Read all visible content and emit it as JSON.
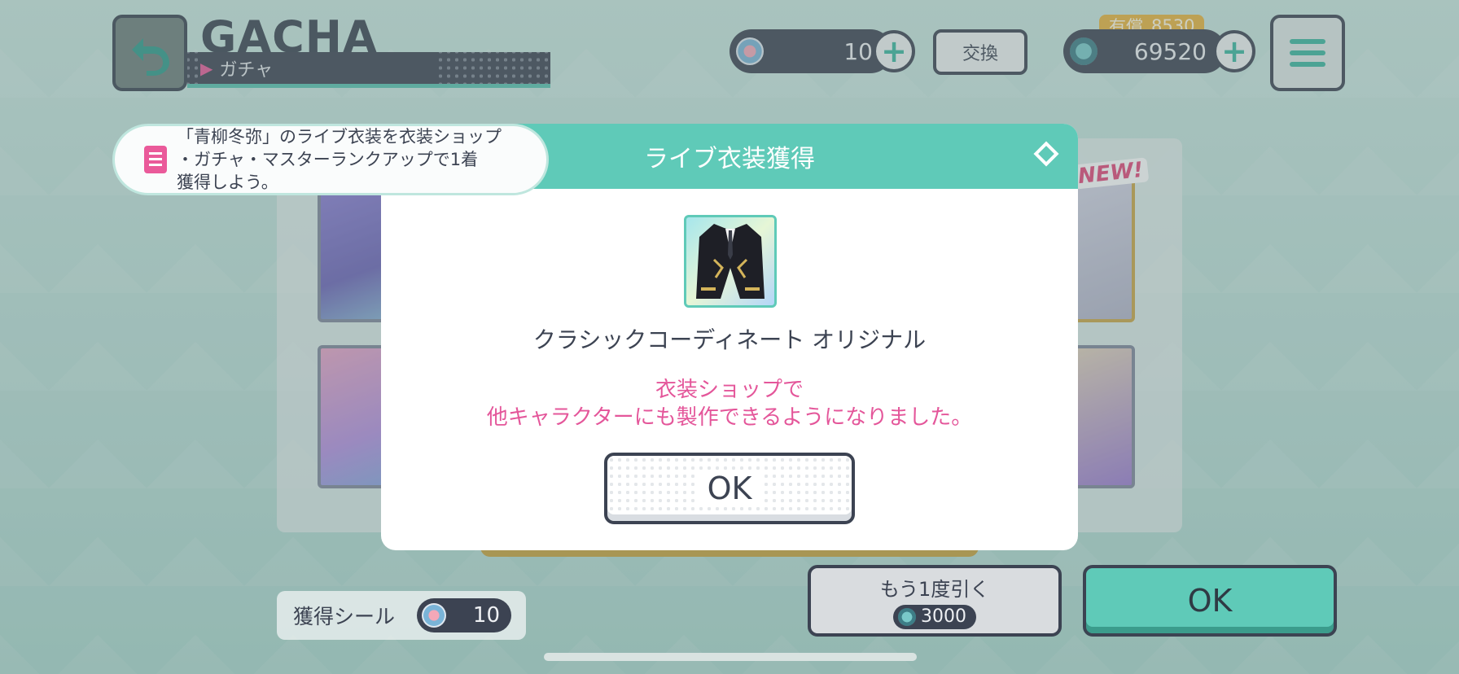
{
  "header": {
    "title": "GACHA",
    "subtitle": "ガチャ",
    "seal_count": "10",
    "exchange_label": "交換",
    "paid_label": "有償",
    "paid_value": "8530",
    "gem_count": "69520"
  },
  "mission": {
    "text_line1": "「青柳冬弥」のライブ衣装を衣装ショップ",
    "text_line2": "・ガチャ・マスターランクアップで1着",
    "text_line3": "獲得しよう。"
  },
  "background": {
    "new_badge": "NEW!"
  },
  "modal": {
    "title": "ライブ衣装獲得",
    "costume_name": "クラシックコーディネート オリジナル",
    "notice_line1": "衣装ショップで",
    "notice_line2": "他キャラクターにも製作できるようになりました。",
    "ok_label": "OK"
  },
  "footer": {
    "seal_label": "獲得シール",
    "seal_value": "10",
    "again_label": "もう1度引く",
    "again_cost": "3000",
    "ok_label": "OK"
  },
  "colors": {
    "accent": "#5fcab8",
    "dark": "#3c4352",
    "pink": "#e4569a",
    "gold": "#e8b23c"
  },
  "icons": {
    "back": "back-arrow-icon",
    "seal": "seal-icon",
    "gem": "crystal-icon",
    "menu": "hamburger-menu-icon",
    "mission": "clipboard-icon"
  }
}
